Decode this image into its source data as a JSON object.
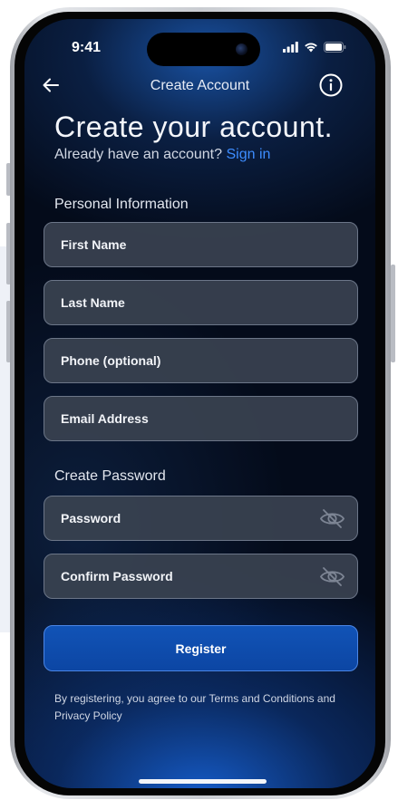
{
  "status_bar": {
    "time": "9:41"
  },
  "header": {
    "title": "Create Account"
  },
  "hero": {
    "headline": "Create your account.",
    "prompt": "Already have an account?",
    "signin_link": "Sign in"
  },
  "personal_section": {
    "label": "Personal Information",
    "fields": [
      {
        "placeholder": "First Name",
        "value": ""
      },
      {
        "placeholder": "Last Name",
        "value": ""
      },
      {
        "placeholder": "Phone (optional)",
        "value": ""
      },
      {
        "placeholder": "Email Address",
        "value": ""
      }
    ]
  },
  "password_section": {
    "label": "Create Password",
    "fields": [
      {
        "placeholder": "Password",
        "value": "",
        "icon": "eye-off-icon"
      },
      {
        "placeholder": "Confirm Password",
        "value": "",
        "icon": "eye-off-icon"
      }
    ]
  },
  "register_label": "Register",
  "legal_text": "By registering, you agree to our Terms and Conditions and Privacy Policy",
  "colors": {
    "accent_link": "#3d8dff",
    "button_bg": "#0c4aa9",
    "field_bg": "#3a4250",
    "screen_bg": "#040b1a"
  }
}
